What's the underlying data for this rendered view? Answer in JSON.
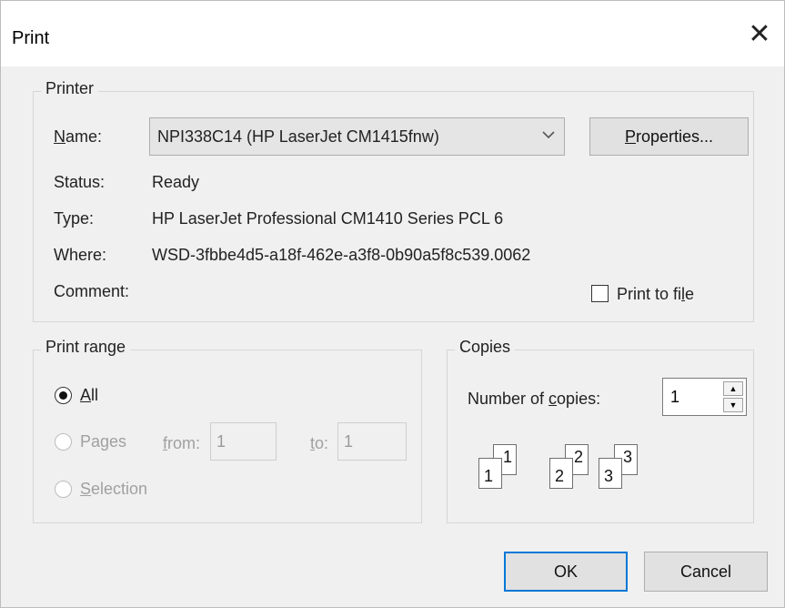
{
  "window": {
    "title": "Print",
    "close_glyph": "✕"
  },
  "printer": {
    "group_label": "Printer",
    "name_label": "Name:",
    "name_value": "NPI338C14 (HP LaserJet CM1415fnw)",
    "properties_label": "Properties...",
    "status_label": "Status:",
    "status_value": "Ready",
    "type_label": "Type:",
    "type_value": "HP LaserJet Professional CM1410 Series PCL 6",
    "where_label": "Where:",
    "where_value": "WSD-3fbbe4d5-a18f-462e-a3f8-0b90a5f8c539.0062",
    "comment_label": "Comment:",
    "print_to_file_label": "Print to file",
    "print_to_file_checked": false
  },
  "print_range": {
    "group_label": "Print range",
    "all_label": "All",
    "pages_label": "Pages",
    "from_label": "from:",
    "from_value": "1",
    "to_label": "to:",
    "to_value": "1",
    "selection_label": "Selection",
    "selected": "all"
  },
  "copies": {
    "group_label": "Copies",
    "number_label": "Number of copies:",
    "number_value": "1",
    "collate_pages": [
      "1",
      "2",
      "3"
    ]
  },
  "buttons": {
    "ok": "OK",
    "cancel": "Cancel"
  },
  "icons": {
    "close": "close-icon",
    "dropdown": "chevron-down-icon",
    "spin_up": "spin-up-icon",
    "spin_down": "spin-down-icon",
    "collate": "collate-pages-icon"
  },
  "colors": {
    "dialog_bg": "#f0f0f0",
    "title_bg": "#ffffff",
    "focus_border": "#0078d7"
  }
}
